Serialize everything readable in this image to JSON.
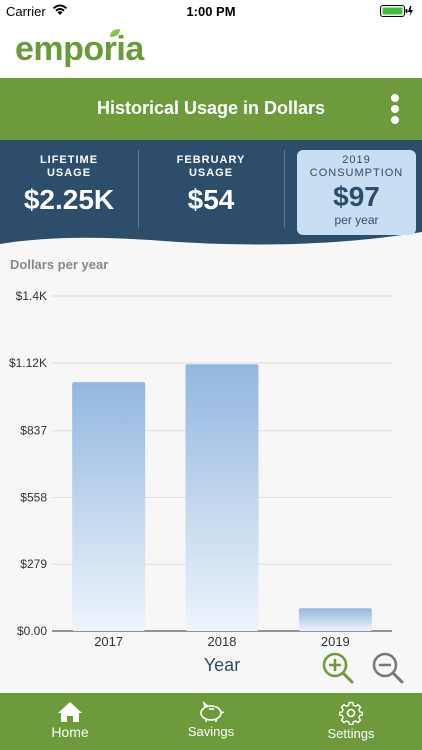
{
  "status_bar": {
    "carrier": "Carrier",
    "time": "1:00 PM"
  },
  "app": {
    "logo": "emporia"
  },
  "header": {
    "title": "Historical Usage in Dollars"
  },
  "stats": {
    "lifetime": {
      "label_line1": "LIFETIME",
      "label_line2": "USAGE",
      "value": "$2.25K"
    },
    "month": {
      "label_line1": "FEBRUARY",
      "label_line2": "USAGE",
      "value": "$54"
    },
    "year": {
      "label_line1": "2019",
      "label_line2": "CONSUMPTION",
      "value": "$97",
      "sub": "per year"
    }
  },
  "chart_data": {
    "type": "bar",
    "title": "Dollars per year",
    "xlabel": "Year",
    "ylabel": "Dollars per year",
    "categories": [
      "2017",
      "2018",
      "2019"
    ],
    "values": [
      1040,
      1115,
      95
    ],
    "ylim": [
      0,
      1400
    ],
    "yticks": [
      0,
      279,
      558,
      837,
      1120,
      1400
    ],
    "ytick_labels": [
      "$0.00",
      "$279",
      "$558",
      "$837",
      "$1.12K",
      "$1.4K"
    ],
    "grid": true
  },
  "controls": {
    "zoom_in": "zoom-in-icon",
    "zoom_out": "zoom-out-icon"
  },
  "tabs": [
    {
      "label": "Home",
      "icon": "home-icon"
    },
    {
      "label": "Savings",
      "icon": "piggy-bank-icon"
    },
    {
      "label": "Settings",
      "icon": "gear-icon"
    }
  ],
  "colors": {
    "brand_green": "#6d9b3c",
    "stats_bg": "#2c4e6b",
    "highlight_bg": "#c8def3",
    "bar_top": "#92b7df",
    "bar_bottom": "#eef4fb"
  }
}
